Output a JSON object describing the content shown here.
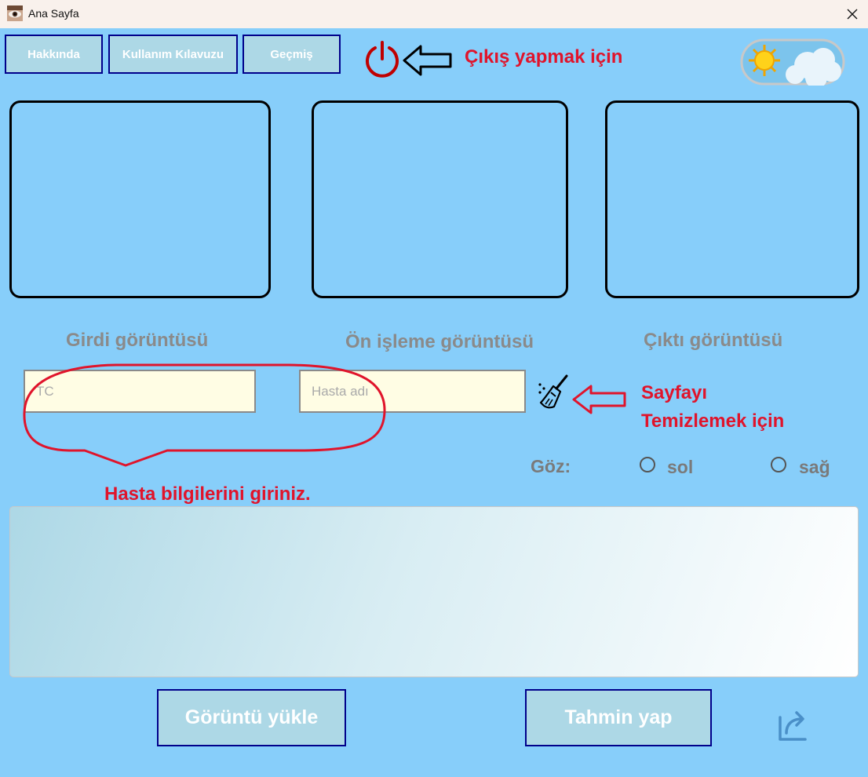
{
  "window": {
    "title": "Ana Sayfa"
  },
  "toolbar": {
    "about_label": "Hakkında",
    "guide_label": "Kullanım Kılavuzu",
    "history_label": "Geçmiş"
  },
  "annotations": {
    "logout_hint": "Çıkış yapmak için",
    "clear_hint_line1": "Sayfayı",
    "clear_hint_line2": "Temizlemek için",
    "patient_hint": "Hasta bilgilerini giriniz."
  },
  "panels": {
    "input_caption": "Girdi görüntüsü",
    "preprocess_caption": "Ön işleme görüntüsü",
    "output_caption": "Çıktı görüntüsü"
  },
  "form": {
    "tc_placeholder": "TC",
    "tc_value": "",
    "name_placeholder": "Hasta adı",
    "name_value": ""
  },
  "eye": {
    "label": "Göz:",
    "options": [
      "sol",
      "sağ"
    ],
    "selected": null
  },
  "actions": {
    "upload_label": "Görüntü yükle",
    "predict_label": "Tahmin yap"
  },
  "icons": {
    "app": "eye-icon",
    "close": "close-icon",
    "power": "power-icon",
    "theme": "sun-cloud-toggle-icon",
    "clear": "broom-icon",
    "share": "share-icon"
  },
  "colors": {
    "background": "#87cefa",
    "button_fill": "#add8e6",
    "button_border": "#00008b",
    "annotation_red": "#e0142b",
    "input_fill": "#fffde4",
    "caption_gray": "#8a8a8a",
    "power_red": "#c00000"
  }
}
